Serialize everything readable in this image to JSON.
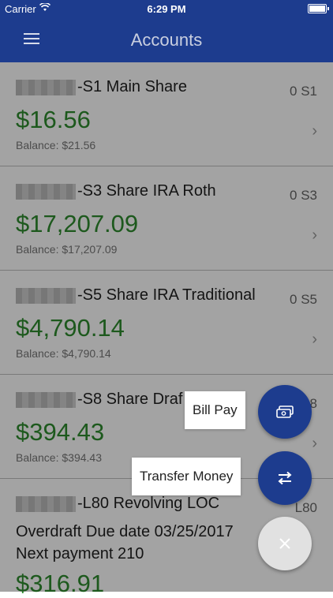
{
  "status": {
    "carrier": "Carrier",
    "time": "6:29 PM"
  },
  "nav": {
    "title": "Accounts",
    "menu_icon": "hamburger-menu-icon"
  },
  "accounts": [
    {
      "name": "-S1 Main Share",
      "code": "0 S1",
      "amount": "$16.56",
      "balance": "Balance: $21.56"
    },
    {
      "name": "-S3 Share IRA Roth",
      "code": "0 S3",
      "amount": "$17,207.09",
      "balance": "Balance: $17,207.09"
    },
    {
      "name": "-S5 Share IRA Traditional",
      "code": "0 S5",
      "amount": "$4,790.14",
      "balance": "Balance: $4,790.14"
    },
    {
      "name": "-S8 Share Draf",
      "code": "8",
      "amount": "$394.43",
      "balance": "Balance: $394.43"
    },
    {
      "name": "-L80 Revolving LOC",
      "code": "L80",
      "line1": "Overdraft Due date 03/25/2017",
      "line2": "Next payment 210",
      "amount": "$316.91"
    }
  ],
  "fab_menu": {
    "bill_pay": {
      "label": "Bill Pay",
      "icon": "cash-icon"
    },
    "transfer": {
      "label": "Transfer Money",
      "icon": "transfer-arrows-icon"
    },
    "close": {
      "icon": "close-icon"
    }
  },
  "colors": {
    "primary": "#1d3c8e",
    "amount_green": "#2e8b2e"
  }
}
